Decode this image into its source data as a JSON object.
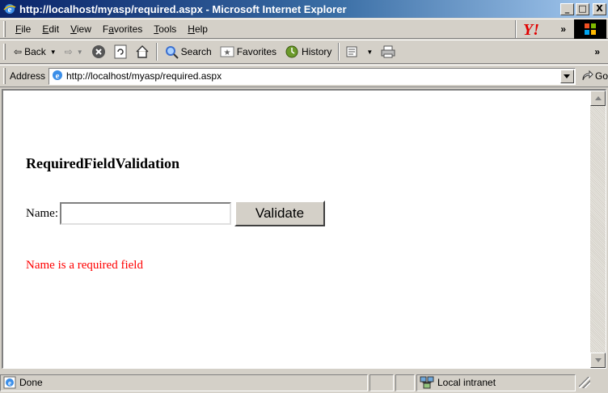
{
  "window": {
    "title": "http://localhost/myasp/required.aspx - Microsoft Internet Explorer",
    "min_glyph": "_",
    "max_glyph": "□",
    "close_glyph": "X"
  },
  "menu": {
    "file": "File",
    "edit": "Edit",
    "view": "View",
    "favorites": "Favorites",
    "tools": "Tools",
    "help": "Help",
    "more": "»"
  },
  "toolbar": {
    "back": "Back",
    "search": "Search",
    "favorites": "Favorites",
    "history": "History",
    "more": "»"
  },
  "address": {
    "label": "Address",
    "url": "http://localhost/myasp/required.aspx",
    "go": "Go"
  },
  "page": {
    "heading": "RequiredFieldValidation",
    "name_label": "Name:",
    "name_value": "",
    "validate_label": "Validate",
    "error_message": "Name is a required field"
  },
  "status": {
    "text": "Done",
    "zone": "Local intranet"
  },
  "colors": {
    "title_start": "#0a246a",
    "title_end": "#a6caf0",
    "chrome": "#d4d0c8",
    "error": "#ff0000"
  },
  "icons": [
    "ie-icon",
    "yahoo-logo",
    "windows-throbber",
    "back-arrow-icon",
    "forward-arrow-icon",
    "stop-icon",
    "refresh-icon",
    "home-icon",
    "search-icon",
    "favorites-icon",
    "history-icon",
    "mail-icon",
    "print-icon",
    "go-arrow-icon",
    "local-intranet-icon"
  ]
}
